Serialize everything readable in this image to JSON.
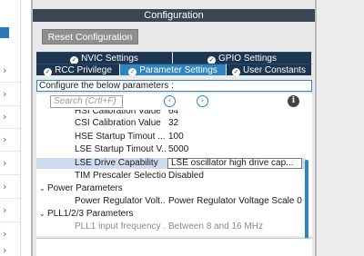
{
  "config": {
    "title": "Configuration",
    "reset_label": "Reset Configuration",
    "tabs_row1": [
      {
        "label": "NVIC Settings"
      },
      {
        "label": "GPIO Settings"
      }
    ],
    "tabs_row2": [
      {
        "label": "RCC Privilege"
      },
      {
        "label": "Parameter Settings"
      },
      {
        "label": "User Constants"
      }
    ],
    "description": "Configure the below parameters :",
    "search_placeholder": "Search (Crtl+F)"
  },
  "params": [
    {
      "name": "HSI Calibration Value",
      "value": "64"
    },
    {
      "name": "CSI Calibration Value",
      "value": "32"
    },
    {
      "name": "HSE Startup Timout ...",
      "value": "100"
    },
    {
      "name": "LSE Startup Timout V...",
      "value": "5000"
    },
    {
      "name": "LSE Drive Capability",
      "value": "LSE oscillator high drive cap..."
    },
    {
      "name": "TIM Prescaler Selection",
      "value": "Disabled"
    },
    {
      "name": "Power Parameters"
    },
    {
      "name": "Power Regulator Volt...",
      "value": "Power Regulator Voltage Scale 0"
    },
    {
      "name": "PLL1/2/3 Parameters"
    },
    {
      "name": "PLL1 input frequency ...",
      "value": "Between 8 and 16 MHz"
    }
  ],
  "colors": {
    "header_bg": "#3c4553",
    "tab_bg": "#1c3550",
    "tab_active": "#2e86c1",
    "selected_row": "#cfdcf0"
  }
}
